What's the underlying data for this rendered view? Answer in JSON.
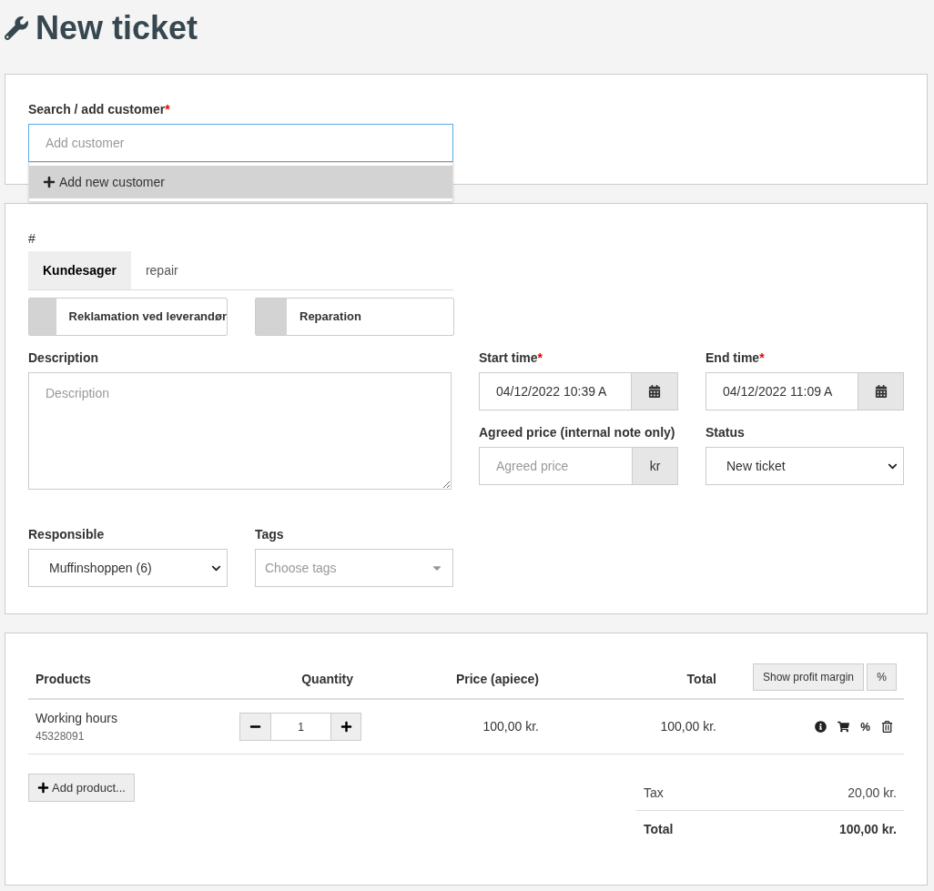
{
  "page": {
    "title": "New ticket"
  },
  "customer": {
    "label": "Search / add customer",
    "required_mark": "*",
    "placeholder": "Add customer",
    "dropdown_item": "Add new customer"
  },
  "ticket": {
    "number_label": "#",
    "tabs": [
      {
        "label": "Kundesager",
        "selected": true
      },
      {
        "label": "repair",
        "selected": false
      }
    ],
    "toggles": [
      {
        "label": "Reklamation ved leverandør",
        "on": false
      },
      {
        "label": "Reparation",
        "on": false
      }
    ],
    "description": {
      "label": "Description",
      "placeholder": "Description"
    },
    "start_time": {
      "label": "Start time",
      "required_mark": "*",
      "value": "04/12/2022 10:39 A"
    },
    "end_time": {
      "label": "End time",
      "required_mark": "*",
      "value": "04/12/2022 11:09 A"
    },
    "agreed_price": {
      "label": "Agreed price (internal note only)",
      "placeholder": "Agreed price",
      "unit": "kr"
    },
    "status": {
      "label": "Status",
      "value": "New ticket"
    },
    "responsible": {
      "label": "Responsible",
      "value": "Muffinshoppen (6)"
    },
    "tags": {
      "label": "Tags",
      "placeholder": "Choose tags"
    }
  },
  "products": {
    "columns": [
      "Products",
      "Quantity",
      "Price (apiece)",
      "Total"
    ],
    "profit_button": "Show profit margin",
    "percent_button": "%",
    "rows": [
      {
        "name": "Working hours",
        "sku": "45328091",
        "quantity": "1",
        "price": "100,00 kr.",
        "total": "100,00 kr.",
        "discount": "%"
      }
    ],
    "add_button": "Add product...",
    "summary": [
      {
        "label": "Tax",
        "value": "20,00 kr.",
        "kind": "normal"
      },
      {
        "label": "Total",
        "value": "100,00 kr.",
        "kind": "total"
      }
    ]
  }
}
